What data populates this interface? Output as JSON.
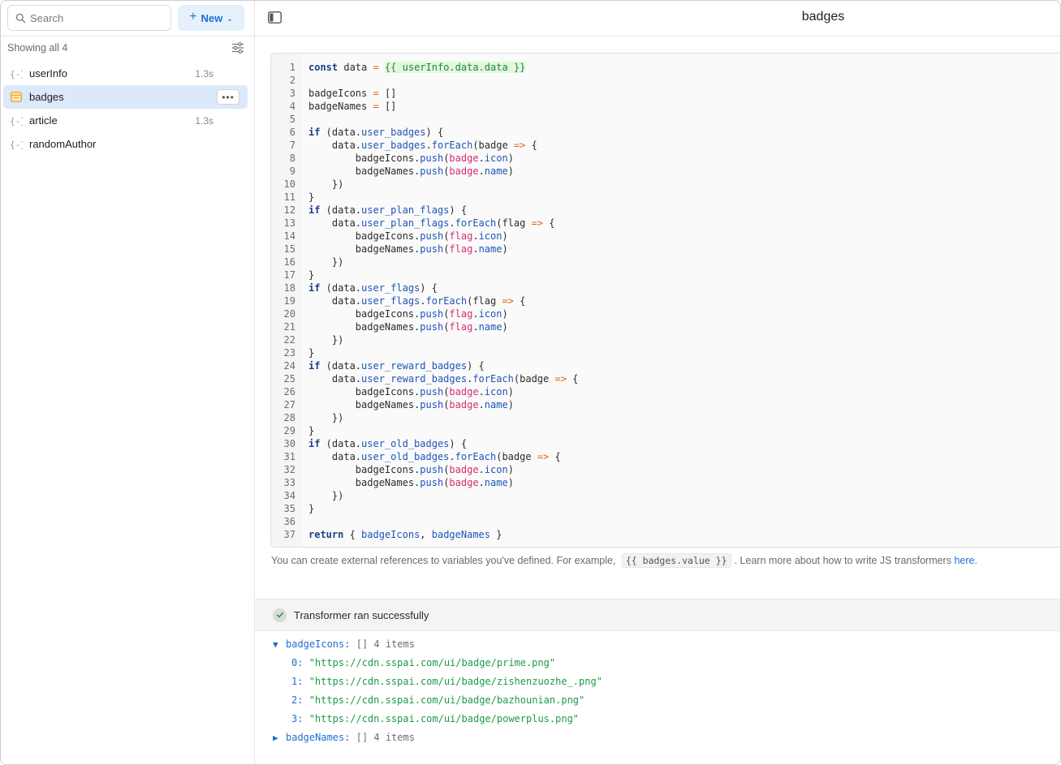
{
  "sidebar": {
    "search_placeholder": "Search",
    "new_label": "New",
    "showing_label": "Showing all 4",
    "queries": [
      {
        "name": "userInfo",
        "time": "1.3s"
      },
      {
        "name": "badges",
        "time": ""
      },
      {
        "name": "article",
        "time": "1.3s"
      },
      {
        "name": "randomAuthor",
        "time": ""
      }
    ],
    "more_label": "•••"
  },
  "header": {
    "title": "badges"
  },
  "helper": {
    "prefix": "You can create external references to variables you've defined. For example,",
    "example": "{{ badges.value }}",
    "middle": ". Learn more about how to write JS transformers",
    "link": "here",
    "suffix": "."
  },
  "result": {
    "status": "Transformer ran successfully",
    "badgeIcons_key": "badgeIcons:",
    "badgeIcons_meta": "[] 4 items",
    "badgeIcons_items": [
      {
        "index": "0:",
        "value": "\"https://cdn.sspai.com/ui/badge/prime.png\""
      },
      {
        "index": "1:",
        "value": "\"https://cdn.sspai.com/ui/badge/zishenzuozhe_.png\""
      },
      {
        "index": "2:",
        "value": "\"https://cdn.sspai.com/ui/badge/bazhounian.png\""
      },
      {
        "index": "3:",
        "value": "\"https://cdn.sspai.com/ui/badge/powerplus.png\""
      }
    ],
    "badgeNames_key": "badgeNames:",
    "badgeNames_meta": "[] 4 items"
  },
  "editor": {
    "lines": [
      "const data = {{ userInfo.data.data }}",
      "",
      "badgeIcons = []",
      "badgeNames = []",
      "",
      "if (data.user_badges) {",
      "    data.user_badges.forEach(badge => {",
      "        badgeIcons.push(badge.icon)",
      "        badgeNames.push(badge.name)",
      "    })",
      "}",
      "if (data.user_plan_flags) {",
      "    data.user_plan_flags.forEach(flag => {",
      "        badgeIcons.push(flag.icon)",
      "        badgeNames.push(flag.name)",
      "    })",
      "}",
      "if (data.user_flags) {",
      "    data.user_flags.forEach(flag => {",
      "        badgeIcons.push(flag.icon)",
      "        badgeNames.push(flag.name)",
      "    })",
      "}",
      "if (data.user_reward_badges) {",
      "    data.user_reward_badges.forEach(badge => {",
      "        badgeIcons.push(badge.icon)",
      "        badgeNames.push(badge.name)",
      "    })",
      "}",
      "if (data.user_old_badges) {",
      "    data.user_old_badges.forEach(badge => {",
      "        badgeIcons.push(badge.icon)",
      "        badgeNames.push(badge.name)",
      "    })",
      "}",
      "",
      "return { badgeIcons, badgeNames }"
    ]
  },
  "colors": {
    "accent": "#1f6fd1",
    "active_row": "#dbe9fa",
    "success_string": "#1d9a4a"
  }
}
